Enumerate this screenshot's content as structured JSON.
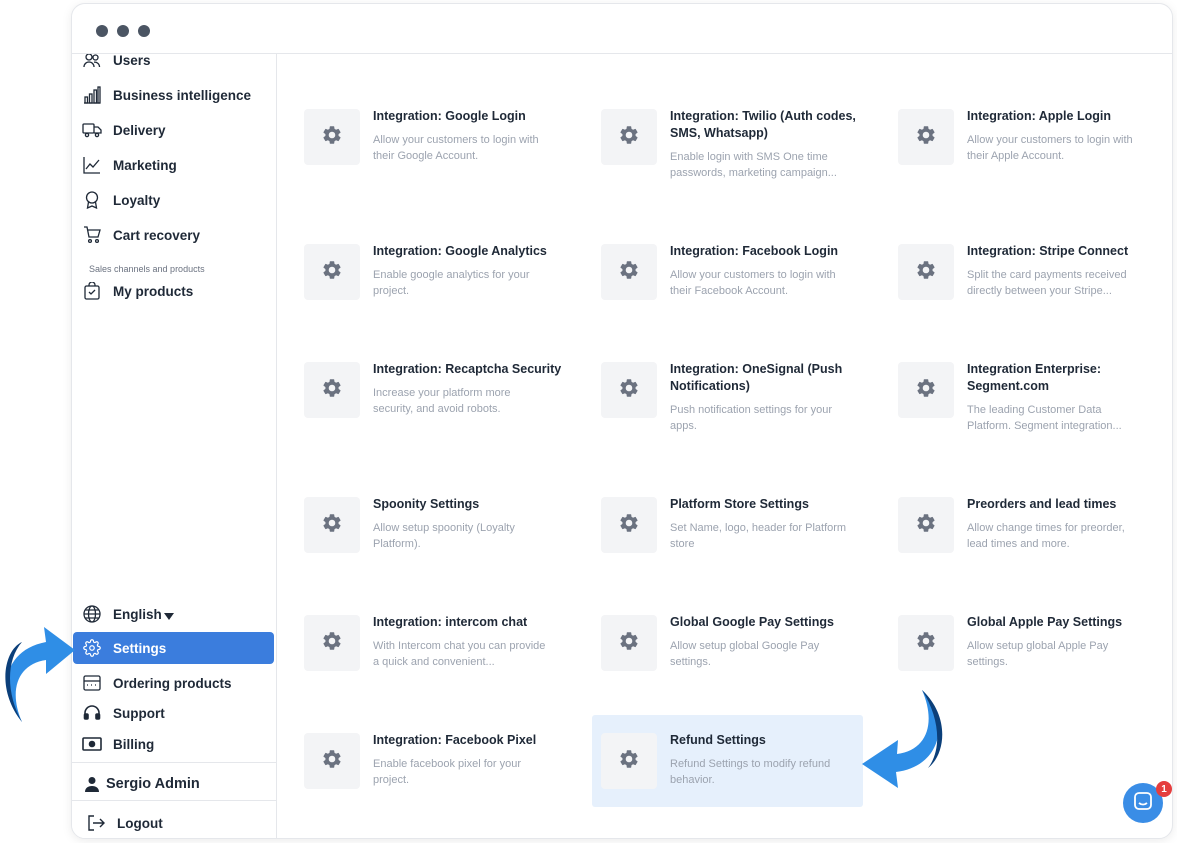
{
  "sidebar": {
    "items_top": [
      {
        "label": "Users",
        "icon": "users-icon"
      },
      {
        "label": "Business intelligence",
        "icon": "bar-chart-icon"
      },
      {
        "label": "Delivery",
        "icon": "truck-icon"
      },
      {
        "label": "Marketing",
        "icon": "line-chart-icon"
      },
      {
        "label": "Loyalty",
        "icon": "award-icon"
      },
      {
        "label": "Cart recovery",
        "icon": "cart-icon"
      }
    ],
    "section_label": "Sales channels and products",
    "my_products": "My products",
    "language": "English",
    "items_bottom": [
      {
        "label": "Settings",
        "icon": "gear-icon",
        "active": true
      },
      {
        "label": "Ordering products",
        "icon": "store-icon"
      },
      {
        "label": "Support",
        "icon": "headset-icon"
      },
      {
        "label": "Billing",
        "icon": "billing-icon"
      }
    ],
    "user_name": "Sergio Admin",
    "logout": "Logout"
  },
  "cards": [
    {
      "title": "Integration: Google Login",
      "desc": "Allow your customers to login with their Google Account."
    },
    {
      "title": "Integration: Twilio (Auth codes, SMS, Whatsapp)",
      "desc": "Enable login with SMS One time passwords, marketing campaign..."
    },
    {
      "title": "Integration: Apple Login",
      "desc": "Allow your customers to login with their Apple Account."
    },
    {
      "title": "Integration: Google Analytics",
      "desc": "Enable google analytics for your project."
    },
    {
      "title": "Integration: Facebook Login",
      "desc": "Allow your customers to login with their Facebook Account."
    },
    {
      "title": "Integration: Stripe Connect",
      "desc": "Split the card payments received directly between your Stripe..."
    },
    {
      "title": "Integration: Recaptcha Security",
      "desc": "Increase your platform more security, and avoid robots."
    },
    {
      "title": "Integration: OneSignal (Push Notifications)",
      "desc": "Push notification settings for your apps."
    },
    {
      "title": "Integration Enterprise: Segment.com",
      "desc": "The leading Customer Data Platform. Segment integration..."
    },
    {
      "title": "Spoonity Settings",
      "desc": "Allow setup spoonity (Loyalty Platform)."
    },
    {
      "title": "Platform Store Settings",
      "desc": "Set Name, logo, header for Platform store"
    },
    {
      "title": "Preorders and lead times",
      "desc": "Allow change times for preorder, lead times and more."
    },
    {
      "title": "Integration: intercom chat",
      "desc": "With Intercom chat you can provide a quick and convenient..."
    },
    {
      "title": "Global Google Pay Settings",
      "desc": "Allow setup global Google Pay settings."
    },
    {
      "title": "Global Apple Pay Settings",
      "desc": "Allow setup global Apple Pay settings."
    },
    {
      "title": "Integration: Facebook Pixel",
      "desc": "Enable facebook pixel for your project."
    },
    {
      "title": "Refund Settings",
      "desc": "Refund Settings to modify refund behavior.",
      "highlighted": true
    }
  ],
  "chat": {
    "badge_count": "1"
  },
  "colors": {
    "accent": "#3b7ddd",
    "arrow": "#2f8ee6",
    "arrow_dark": "#0b3f7a",
    "tile": "#f3f4f6",
    "highlight": "#e6f0fc"
  }
}
